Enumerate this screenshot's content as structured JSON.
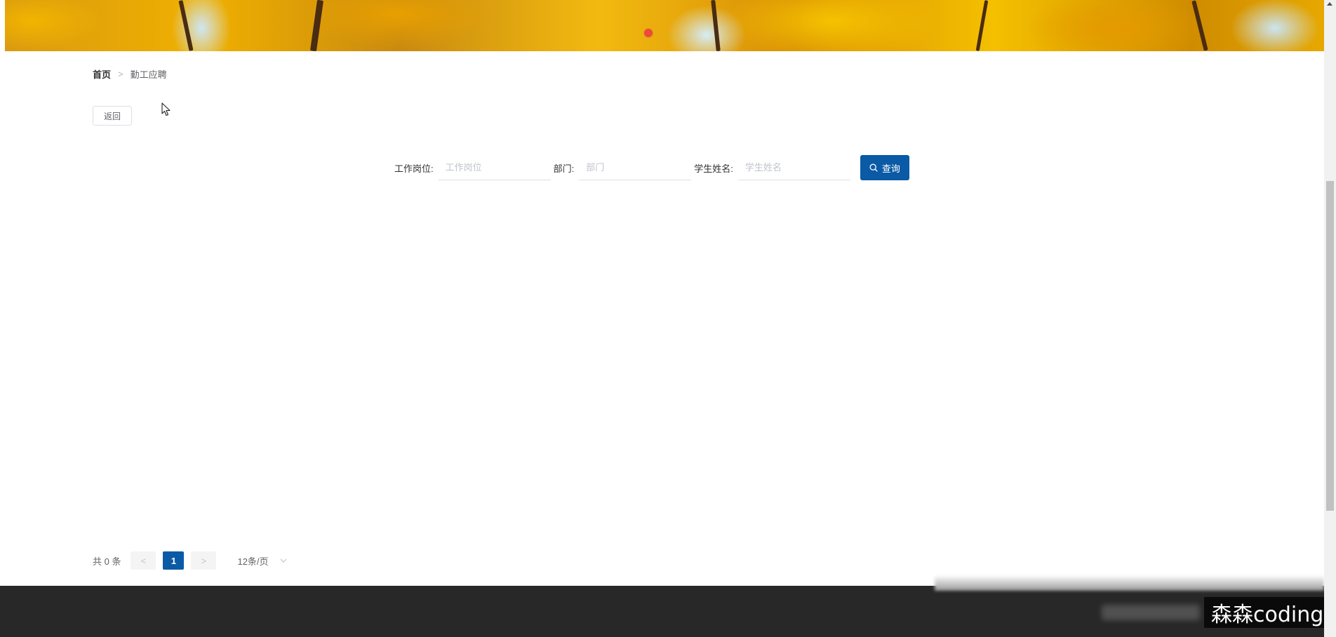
{
  "breadcrumb": {
    "home": "首页",
    "separator": ">",
    "current": "勤工应聘"
  },
  "back_button": {
    "label": "返回"
  },
  "search": {
    "fields": [
      {
        "label": "工作岗位:",
        "placeholder": "工作岗位"
      },
      {
        "label": "部门:",
        "placeholder": "部门"
      },
      {
        "label": "学生姓名:",
        "placeholder": "学生姓名"
      }
    ],
    "button_label": "查询",
    "button_icon": "search-icon"
  },
  "pagination": {
    "total_text": "共 0 条",
    "prev": "<",
    "current_page": "1",
    "next": ">",
    "page_size": "12条/页"
  },
  "watermark": "森森coding",
  "colors": {
    "primary": "#0b5aa6",
    "footer": "#282828",
    "carousel_dot": "#f0483e"
  }
}
